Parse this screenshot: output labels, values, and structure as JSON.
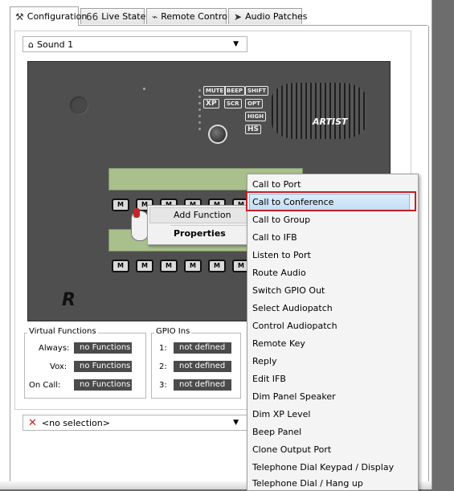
{
  "tabs": [
    {
      "label": "Configuration",
      "icon": "tools-icon",
      "active": true
    },
    {
      "label": "Live State",
      "icon": "glasses-icon",
      "active": false
    },
    {
      "label": "Remote Control",
      "icon": "remote-icon",
      "active": false
    },
    {
      "label": "Audio Patches",
      "icon": "patch-icon",
      "active": false
    }
  ],
  "sound_selector": {
    "value": "Sound 1"
  },
  "panel": {
    "mini_buttons": [
      "MUTE",
      "BEEP",
      "SHIFT",
      "XP",
      "SCR",
      "OPT",
      "HIGH",
      "HS"
    ],
    "brand": "ARTIST",
    "key_label": "M",
    "logo": "R"
  },
  "virtual_functions": {
    "title": "Virtual Functions",
    "rows": [
      {
        "label": "Always:",
        "value": "no Functions"
      },
      {
        "label": "Vox:",
        "value": "no Functions"
      },
      {
        "label": "On Call:",
        "value": "no Functions"
      }
    ]
  },
  "gpio_ins": {
    "title": "GPIO Ins",
    "rows": [
      {
        "label": "1:",
        "value": "not defined"
      },
      {
        "label": "2:",
        "value": "not defined"
      },
      {
        "label": "3:",
        "value": "not defined"
      }
    ]
  },
  "selection_combo": {
    "value": "<no selection>"
  },
  "context_menu": {
    "items": [
      "Add Function",
      "Properties"
    ]
  },
  "submenu": {
    "highlighted_index": 1,
    "items": [
      "Call to Port",
      "Call to Conference",
      "Call to Group",
      "Call to IFB",
      "Listen to Port",
      "Route Audio",
      "Switch GPIO Out",
      "Select Audiopatch",
      "Control Audiopatch",
      "Remote Key",
      "Reply",
      "Edit IFB",
      "Dim Panel Speaker",
      "Dim XP Level",
      "Beep Panel",
      "Clone Output Port",
      "Telephone Dial Keypad / Display",
      "Telephone Dial / Hang up"
    ]
  },
  "colors": {
    "highlight_border": "#c0202a",
    "lcd": "#a9bf8c",
    "panel": "#4f4f4f"
  }
}
